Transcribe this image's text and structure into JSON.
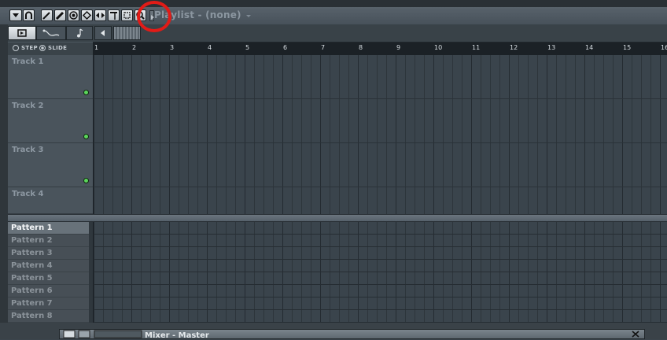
{
  "playlist": {
    "title": "Playlist - (none)"
  },
  "mode": {
    "step_label": "STEP",
    "slide_label": "SLIDE"
  },
  "ruler": {
    "bars": [
      "1",
      "2",
      "3",
      "4",
      "5",
      "6",
      "7",
      "8",
      "9",
      "10",
      "11",
      "12",
      "13",
      "14",
      "15",
      "16"
    ]
  },
  "tracks": [
    "Track 1",
    "Track 2",
    "Track 3",
    "Track 4"
  ],
  "patterns": [
    "Pattern 1",
    "Pattern 2",
    "Pattern 3",
    "Pattern 4",
    "Pattern 5",
    "Pattern 6",
    "Pattern 7",
    "Pattern 8"
  ],
  "selected_pattern": "Pattern 1",
  "mixer": {
    "title": "Mixer - Master"
  },
  "colors": {
    "highlight": "#e11b17",
    "led": "#5cd65c"
  }
}
